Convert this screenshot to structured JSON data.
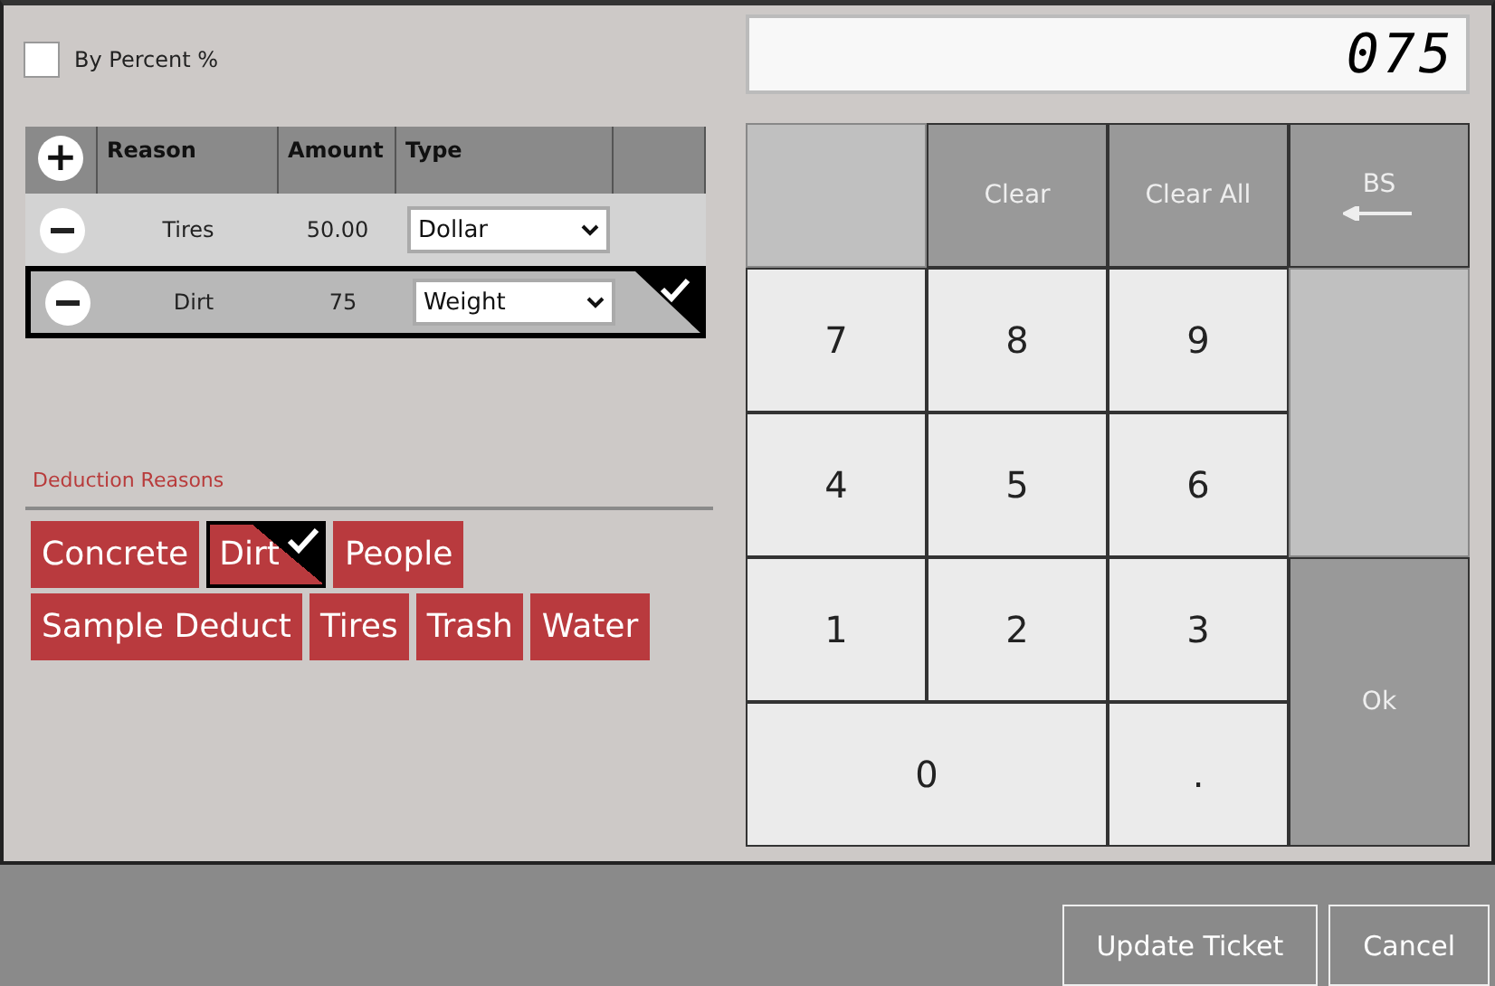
{
  "by_percent": {
    "label": "By Percent %",
    "checked": false
  },
  "table": {
    "add_button": "+",
    "columns": [
      "Reason",
      "Amount",
      "Type"
    ],
    "rows": [
      {
        "reason": "Tires",
        "amount": "50.00",
        "type": "Dollar",
        "selected": false
      },
      {
        "reason": "Dirt",
        "amount": "75",
        "type": "Weight",
        "selected": true
      }
    ]
  },
  "deduction_reasons": {
    "title": "Deduction Reasons",
    "items": [
      {
        "label": "Concrete",
        "selected": false
      },
      {
        "label": "Dirt",
        "selected": true
      },
      {
        "label": "People",
        "selected": false
      },
      {
        "label": "Sample Deduct",
        "selected": false
      },
      {
        "label": "Tires",
        "selected": false
      },
      {
        "label": "Trash",
        "selected": false
      },
      {
        "label": "Water",
        "selected": false
      }
    ]
  },
  "keypad": {
    "display": "075",
    "keys": [
      {
        "kind": "blank"
      },
      {
        "kind": "action",
        "label": "Clear"
      },
      {
        "kind": "action",
        "label": "Clear All"
      },
      {
        "kind": "backspace",
        "label": "BS"
      },
      {
        "kind": "digit",
        "label": "7"
      },
      {
        "kind": "digit",
        "label": "8"
      },
      {
        "kind": "digit",
        "label": "9"
      },
      {
        "kind": "filler"
      },
      {
        "kind": "digit",
        "label": "4"
      },
      {
        "kind": "digit",
        "label": "5"
      },
      {
        "kind": "digit",
        "label": "6"
      },
      {
        "kind": "digit",
        "label": "1"
      },
      {
        "kind": "digit",
        "label": "2"
      },
      {
        "kind": "digit",
        "label": "3"
      },
      {
        "kind": "ok",
        "label": "Ok"
      },
      {
        "kind": "wide",
        "label": "0"
      },
      {
        "kind": "digit",
        "label": "."
      }
    ]
  },
  "footer_buttons": [
    "Update Ticket",
    "Cancel"
  ]
}
